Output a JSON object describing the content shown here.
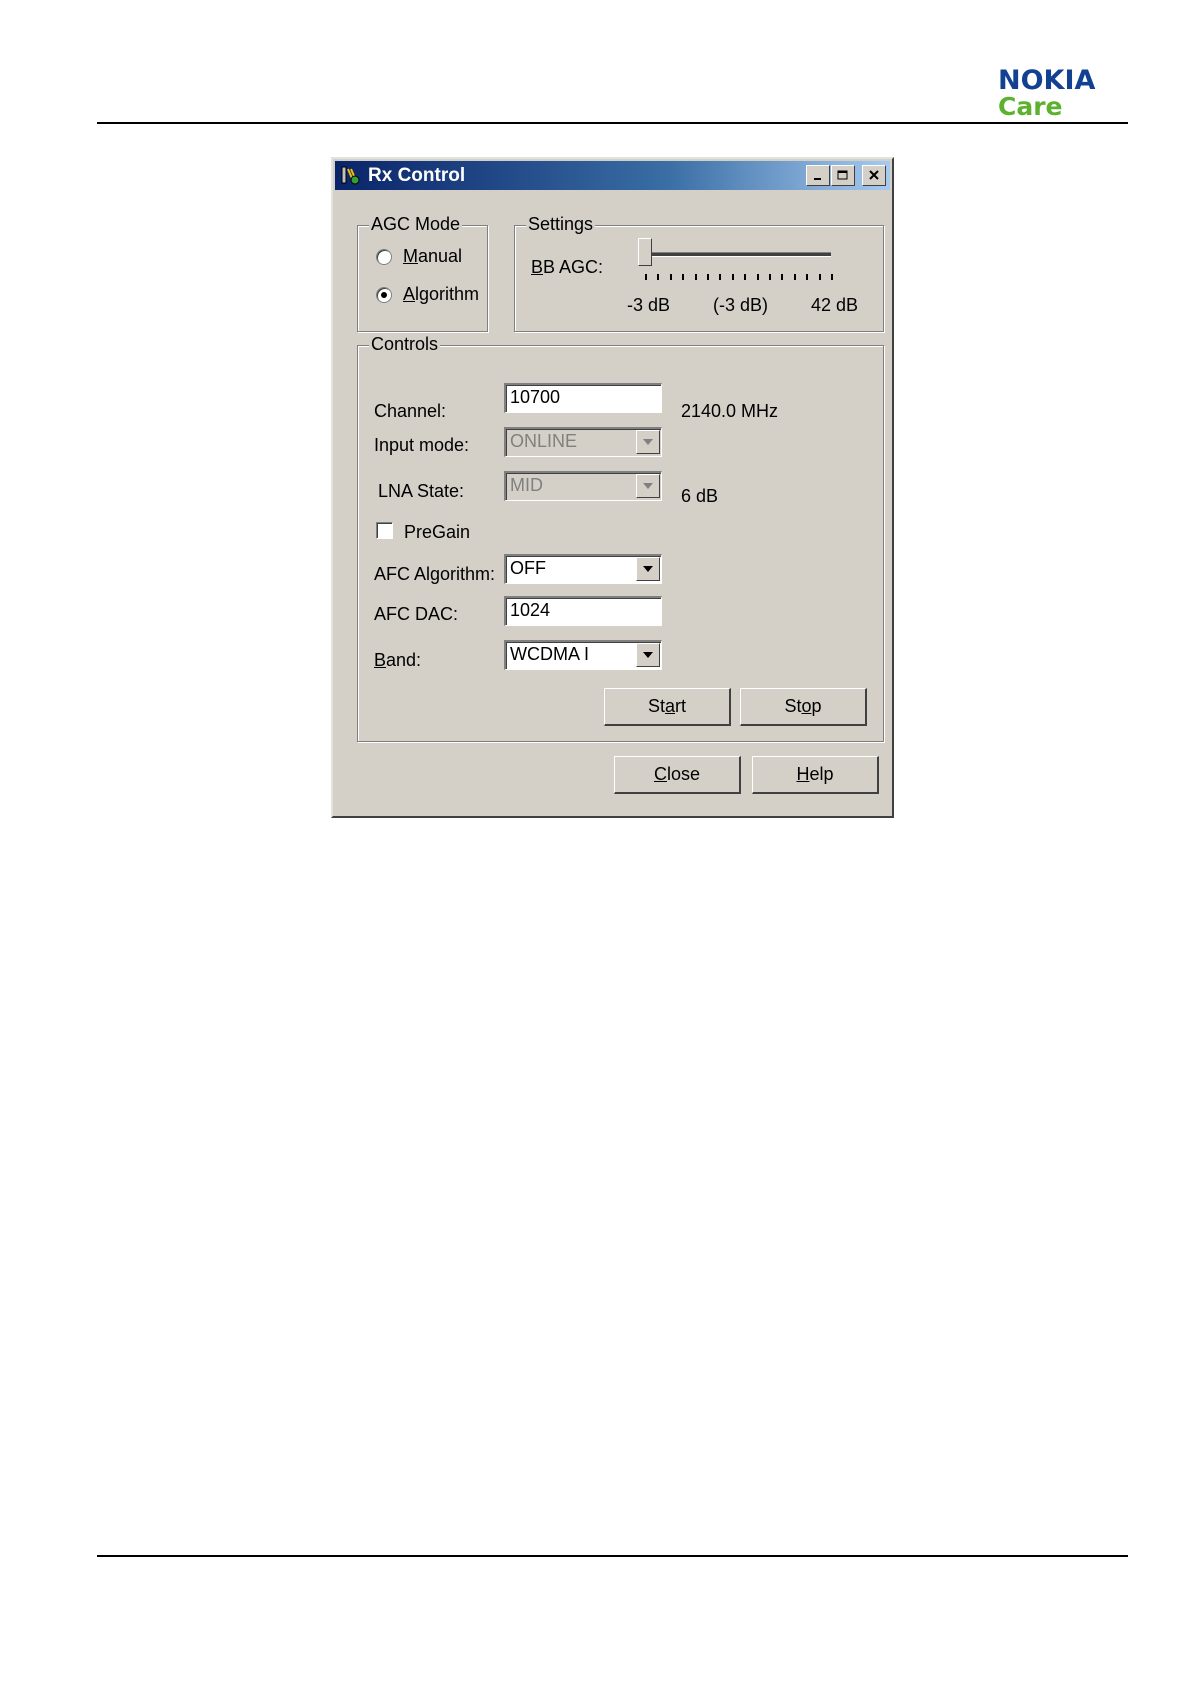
{
  "logo": {
    "brand": "NOKIA",
    "sub": "Care"
  },
  "window": {
    "title": "Rx Control"
  },
  "agc_mode": {
    "legend": "AGC Mode",
    "manual": {
      "label": "Manual",
      "selected": false
    },
    "algorithm": {
      "label": "Algorithm",
      "selected": true
    }
  },
  "settings": {
    "legend": "Settings",
    "bb_agc_label": "BB AGC:",
    "min_label": "-3 dB",
    "value_label": "(-3 dB)",
    "max_label": "42 dB",
    "slider_value_fraction": 0.0
  },
  "controls": {
    "legend": "Controls",
    "channel": {
      "label": "Channel:",
      "value": "10700",
      "freq": "2140.0 MHz"
    },
    "input_mode": {
      "label": "Input mode:",
      "value": "ONLINE"
    },
    "lna_state": {
      "label": "LNA State:",
      "value": "MID",
      "gain": "6 dB"
    },
    "pregain": {
      "label": "PreGain",
      "checked": false
    },
    "afc_algorithm": {
      "label": "AFC Algorithm:",
      "value": "OFF"
    },
    "afc_dac": {
      "label": "AFC DAC:",
      "value": "1024"
    },
    "band": {
      "label": "Band:",
      "value": "WCDMA I"
    },
    "start": "Start",
    "stop": "Stop"
  },
  "footer": {
    "close": "Close",
    "help": "Help"
  }
}
